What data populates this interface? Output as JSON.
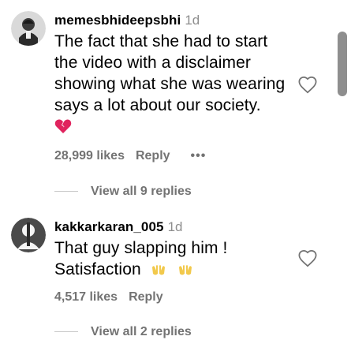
{
  "comments": [
    {
      "username": "memesbhideepsbhi",
      "time": "1d",
      "lines": [
        "The fact that she had to start",
        "the video with a disclaimer",
        "showing what she was wearing",
        "says a lot about our society."
      ],
      "emoji_line": "💔",
      "likes": "28,999 likes",
      "reply": "Reply",
      "more": "•••",
      "view_replies": "View all 9 replies"
    },
    {
      "username": "kakkarkaran_005",
      "time": "1d",
      "lines": [
        "That guy slapping him !"
      ],
      "last_line_text": "Satisfaction",
      "last_line_emoji": "🙌 🙌",
      "likes": "4,517 likes",
      "reply": "Reply",
      "view_replies": "View all 2 replies"
    }
  ],
  "icons": {
    "like": "heart-outline-icon",
    "broken_heart": "broken-heart-emoji",
    "raising_hands": "raising-hands-emoji"
  },
  "colors": {
    "secondary_text": "#737373",
    "timestamp": "#8e8e8e",
    "broken_heart": "#e0245e",
    "scrollbar": "#8e8e8e"
  }
}
